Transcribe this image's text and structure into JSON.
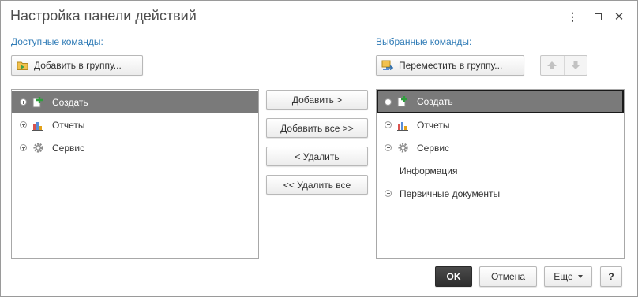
{
  "window": {
    "title": "Настройка панели действий",
    "controls": {
      "more": "⋮",
      "close": "✕"
    }
  },
  "left": {
    "label": "Доступные команды:",
    "add_to_group": "Добавить в группу...",
    "items": [
      {
        "label": "Создать",
        "icon": "create-icon",
        "expandable": true,
        "selected": true
      },
      {
        "label": "Отчеты",
        "icon": "reports-icon",
        "expandable": true,
        "selected": false
      },
      {
        "label": "Сервис",
        "icon": "service-icon",
        "expandable": true,
        "selected": false
      }
    ]
  },
  "middle": {
    "add": "Добавить >",
    "add_all": "Добавить все >>",
    "remove": "< Удалить",
    "remove_all": "<< Удалить все"
  },
  "right": {
    "label": "Выбранные команды:",
    "move_to_group": "Переместить в группу...",
    "items": [
      {
        "label": "Создать",
        "icon": "create-icon",
        "expandable": true,
        "selected": true
      },
      {
        "label": "Отчеты",
        "icon": "reports-icon",
        "expandable": true,
        "selected": false
      },
      {
        "label": "Сервис",
        "icon": "service-icon",
        "expandable": true,
        "selected": false
      },
      {
        "label": "Информация",
        "icon": "",
        "expandable": false,
        "selected": false
      },
      {
        "label": "Первичные документы",
        "icon": "",
        "expandable": true,
        "selected": false
      }
    ]
  },
  "footer": {
    "ok": "OK",
    "cancel": "Отмена",
    "more": "Еще",
    "help": "?"
  },
  "colors": {
    "accent_label": "#2f7bb6",
    "selected_row": "#7a7a7a",
    "ok_button": "#3a3a3a"
  }
}
